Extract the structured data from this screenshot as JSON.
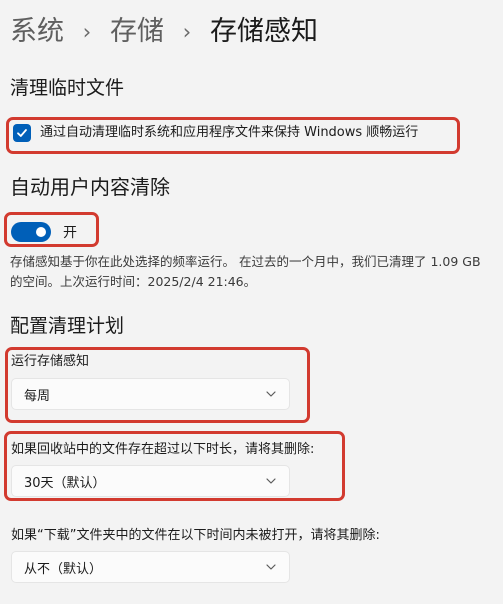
{
  "breadcrumb": {
    "items": [
      "系统",
      "存储"
    ],
    "current": "存储感知"
  },
  "cleanup_temp": {
    "title": "清理临时文件",
    "checkbox_label": "通过自动清理临时系统和应用程序文件来保持 Windows 顺畅运行",
    "checked": true
  },
  "auto_cleanup": {
    "title": "自动用户内容清除",
    "toggle_state_label": "开",
    "enabled": true,
    "description": "存储感知基于你在此处选择的频率运行。 在过去的一个月中，我们已清理了 1.09 GB 的空间。上次运行时间：2025/2/4 21:46。"
  },
  "schedule": {
    "title": "配置清理计划",
    "run_label": "运行存储感知",
    "run_value": "每周",
    "recycle_label": "如果回收站中的文件存在超过以下时长，请将其删除:",
    "recycle_value": "30天（默认）",
    "downloads_label": "如果“下载”文件夹中的文件在以下时间内未被打开，请将其删除:",
    "downloads_value": "从不（默认）"
  },
  "colors": {
    "accent": "#005fb8",
    "highlight_box": "#d23a2f",
    "background": "#f3f3f3"
  },
  "icons": {
    "breadcrumb_separator": "chevron-right-icon",
    "checkbox": "checkmark-icon",
    "dropdown": "chevron-down-icon"
  }
}
